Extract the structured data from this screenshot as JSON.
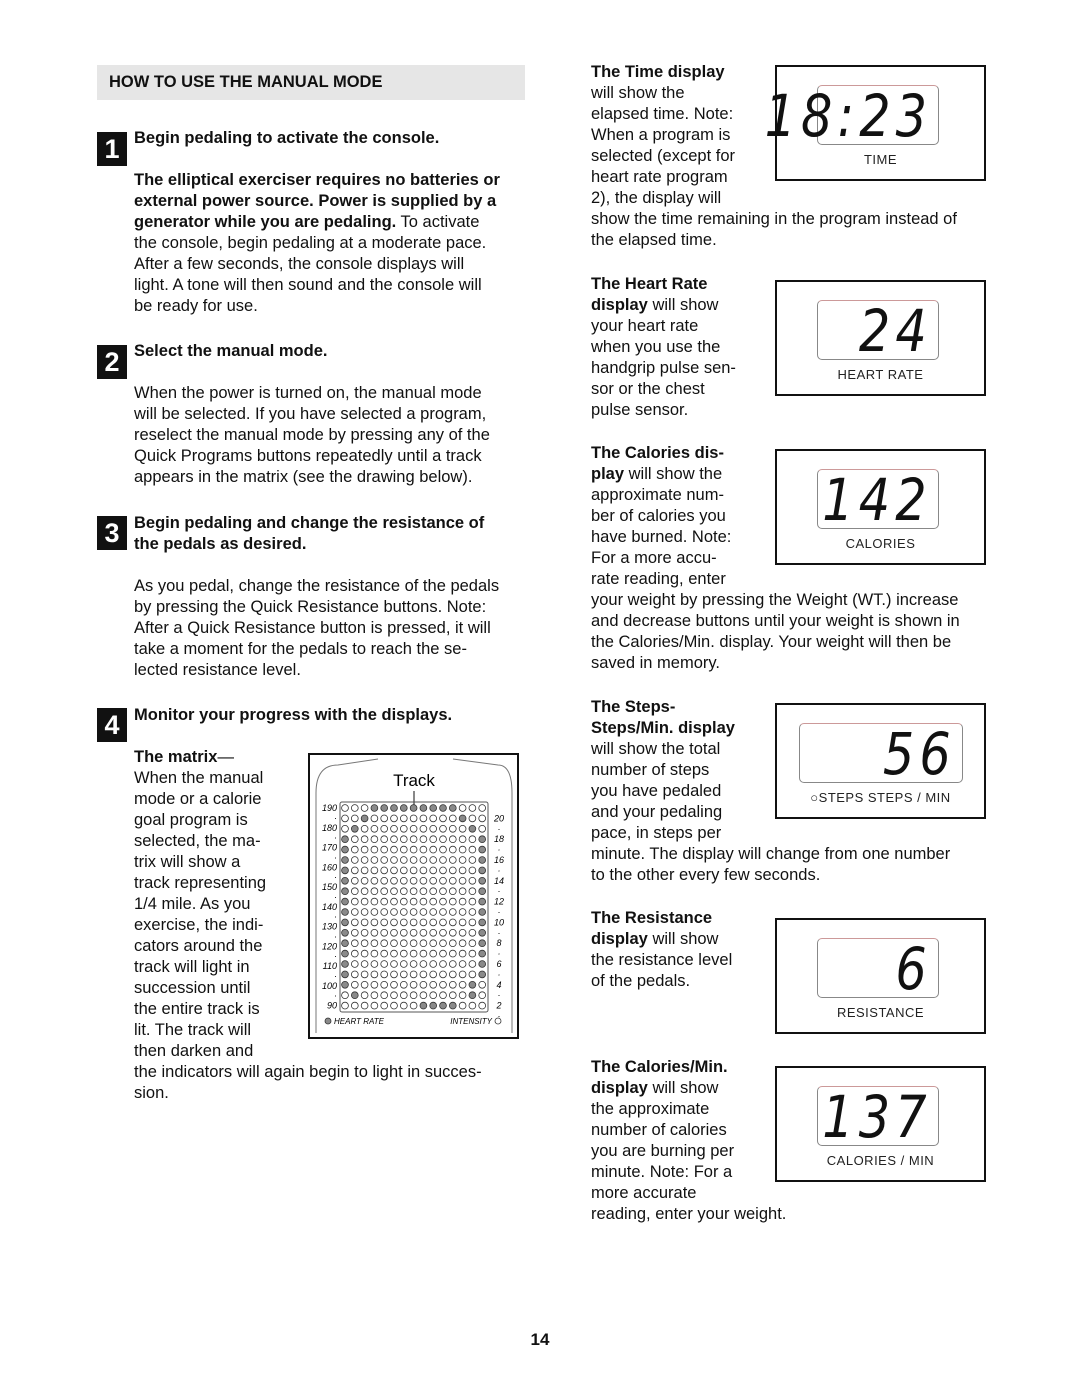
{
  "left": {
    "header": "HOW TO USE THE MANUAL MODE",
    "steps": [
      {
        "num": "1",
        "heading": [
          "Begin pedaling to activate the console."
        ],
        "body": [
          {
            "b": "The elliptical exerciser requires no batteries or"
          },
          {
            "b": "external power source. Power is supplied by a"
          },
          {
            "b": "generator while you are pedaling.",
            "t": " To activate"
          },
          {
            "t": "the console, begin pedaling at a moderate pace."
          },
          {
            "t": "After a few seconds, the console displays will"
          },
          {
            "t": "light. A tone will then sound and the console will"
          },
          {
            "t": "be ready for use."
          }
        ]
      },
      {
        "num": "2",
        "heading": [
          "Select the manual mode."
        ],
        "body": [
          {
            "t": "When the power is turned on, the manual mode"
          },
          {
            "t": "will be selected. If you have selected a program,"
          },
          {
            "t": "reselect the manual mode by pressing any of the"
          },
          {
            "t": "Quick Programs buttons repeatedly until a track"
          },
          {
            "t": "appears in the matrix (see the drawing below)."
          }
        ]
      },
      {
        "num": "3",
        "heading": [
          "Begin pedaling and change the resistance of",
          "the pedals as desired."
        ],
        "body": [
          {
            "t": "As you pedal, change the resistance of the pedals"
          },
          {
            "t": "by pressing the Quick Resistance buttons. Note:"
          },
          {
            "t": "After a Quick Resistance button is pressed, it will"
          },
          {
            "t": "take a moment for the pedals to reach the se-"
          },
          {
            "t": "lected resistance level."
          }
        ]
      },
      {
        "num": "4",
        "heading": [
          "Monitor your progress with the displays."
        ],
        "body": [
          {
            "b": "The matrix",
            "t": "—"
          },
          {
            "t": "When the manual"
          },
          {
            "t": "mode or a calorie"
          },
          {
            "t": "goal program is"
          },
          {
            "t": "selected, the ma-"
          },
          {
            "t": "trix will show a"
          },
          {
            "t": "track representing"
          },
          {
            "t": "1/4 mile. As you"
          },
          {
            "t": "exercise, the indi-"
          },
          {
            "t": "cators around the"
          },
          {
            "t": "track will light in"
          },
          {
            "t": "succession until"
          },
          {
            "t": "the entire track is"
          },
          {
            "t": "lit. The track will"
          },
          {
            "t": "then darken and"
          },
          {
            "t": "the indicators will again begin to light in succes-"
          },
          {
            "t": "sion."
          }
        ]
      }
    ]
  },
  "matrix": {
    "title": "Track",
    "left_ticks": [
      "190",
      "·",
      "180",
      "·",
      "170",
      "·",
      "160",
      "·",
      "150",
      "·",
      "140",
      "·",
      "130",
      "·",
      "120",
      "·",
      "110",
      "·",
      "100",
      "·",
      "90"
    ],
    "right_ticks": [
      "20",
      "·",
      "18",
      "·",
      "16",
      "·",
      "14",
      "·",
      "12",
      "·",
      "10",
      "·",
      "8",
      "·",
      "6",
      "·",
      "4",
      "·",
      "2",
      "·"
    ],
    "legend_left": "HEART RATE",
    "legend_right": "INTENSITY",
    "lit": [
      "000111111111000",
      "001000000000100",
      "010000000000010",
      "100000000000001",
      "100000000000001",
      "100000000000001",
      "100000000000001",
      "100000000000001",
      "100000000000001",
      "100000000000001",
      "100000000000001",
      "100000000000001",
      "100000000000001",
      "100000000000001",
      "100000000000001",
      "100000000000001",
      "100000000000001",
      "100000000000010",
      "010000000000010",
      "000000001111000"
    ],
    "lit_color": "#8a8a8a"
  },
  "right": [
    {
      "id": "time",
      "digits": "18:23",
      "label": "TIME",
      "body": [
        {
          "b": "The Time display"
        },
        {
          "t": "will show the"
        },
        {
          "t": "elapsed time. Note:"
        },
        {
          "t": "When a program is"
        },
        {
          "t": "selected (except for"
        },
        {
          "t": "heart rate program"
        },
        {
          "t": "2), the display will"
        },
        {
          "t": "show the time remaining in the program instead of"
        },
        {
          "t": "the elapsed time."
        }
      ]
    },
    {
      "id": "heart-rate",
      "digits": "24",
      "label": "HEART RATE",
      "body": [
        {
          "b": "The Heart Rate"
        },
        {
          "b": "display",
          "t": " will show"
        },
        {
          "t": "your heart rate"
        },
        {
          "t": "when you use the"
        },
        {
          "t": "handgrip pulse sen-"
        },
        {
          "t": "sor or the chest"
        },
        {
          "t": "pulse sensor."
        }
      ]
    },
    {
      "id": "calories",
      "digits": "142",
      "label": "CALORIES",
      "body": [
        {
          "b": "The Calories dis-"
        },
        {
          "b": "play",
          "t": " will show the"
        },
        {
          "t": "approximate num-"
        },
        {
          "t": "ber of calories you"
        },
        {
          "t": "have burned. Note:"
        },
        {
          "t": "For a more accu-"
        },
        {
          "t": "rate reading, enter"
        },
        {
          "t": "your weight by pressing the Weight (WT.) increase"
        },
        {
          "t": "and decrease buttons until your weight is shown in"
        },
        {
          "t": "the Calories/Min. display. Your weight will then be"
        },
        {
          "t": "saved in memory."
        }
      ]
    },
    {
      "id": "steps",
      "digits": "56",
      "label": "○STEPS   STEPS / MIN",
      "body": [
        {
          "b": "The Steps-"
        },
        {
          "b": "Steps/Min. display"
        },
        {
          "t": "will show the total"
        },
        {
          "t": "number of steps"
        },
        {
          "t": "you have pedaled"
        },
        {
          "t": "and your pedaling"
        },
        {
          "t": "pace, in steps per"
        },
        {
          "t": "minute. The display will change from one number"
        },
        {
          "t": "to the other every few seconds."
        }
      ]
    },
    {
      "id": "resistance",
      "digits": "6",
      "label": "RESISTANCE",
      "body": [
        {
          "b": "The Resistance"
        },
        {
          "b": "display",
          "t": " will show"
        },
        {
          "t": "the resistance level"
        },
        {
          "t": "of the pedals."
        }
      ]
    },
    {
      "id": "calories-min",
      "digits": "137",
      "label": "CALORIES / MIN",
      "body": [
        {
          "b": "The Calories/Min."
        },
        {
          "b": "display",
          "t": " will show"
        },
        {
          "t": "the approximate"
        },
        {
          "t": "number of calories"
        },
        {
          "t": "you are burning per"
        },
        {
          "t": "minute. Note: For a"
        },
        {
          "t": "more accurate"
        },
        {
          "t": "reading, enter your weight."
        }
      ]
    }
  ],
  "page_number": "14"
}
